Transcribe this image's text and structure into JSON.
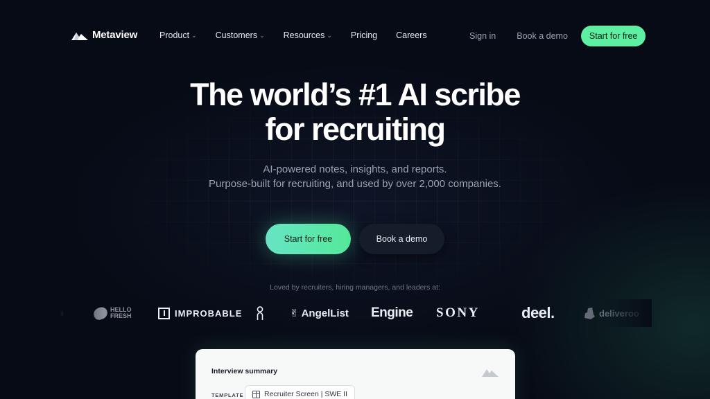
{
  "nav": {
    "brand": "Metaview",
    "links": [
      {
        "label": "Product",
        "dropdown": true
      },
      {
        "label": "Customers",
        "dropdown": true
      },
      {
        "label": "Resources",
        "dropdown": true
      },
      {
        "label": "Pricing",
        "dropdown": false
      },
      {
        "label": "Careers",
        "dropdown": false
      }
    ],
    "sign_in": "Sign in",
    "book_demo": "Book a demo",
    "start_free": "Start for free"
  },
  "hero": {
    "title_line1": "The world’s #1 AI scribe",
    "title_line2": "for recruiting",
    "sub_line1": "AI-powered notes, insights, and reports.",
    "sub_line2": "Purpose-built for recruiting, and used by over 2,000 companies.",
    "cta_primary": "Start for free",
    "cta_secondary": "Book a demo"
  },
  "logos": {
    "caption": "Loved by recruiters, hiring managers, and leaders at:",
    "hellofresh_1": "HELLO",
    "hellofresh_2": "FRESH",
    "improbable": "IMPROBABLE",
    "on": "On",
    "angellist": "AngelList",
    "engine": "Engine",
    "sony": "SONY",
    "deel": "deel.",
    "deliveroo": "deliveroo"
  },
  "card": {
    "title": "Interview summary",
    "template_label": "TEMPLATE",
    "template_value": "Recruiter Screen | SWE II"
  },
  "colors": {
    "accent": "#5ef0a2",
    "background": "#070b16"
  }
}
